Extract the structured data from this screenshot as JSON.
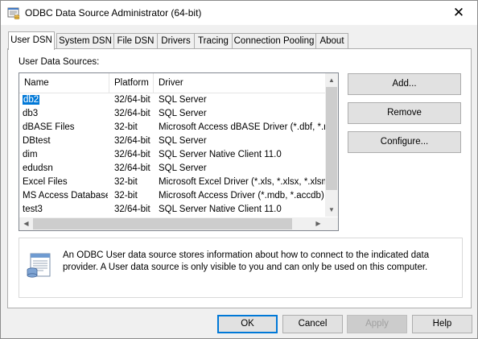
{
  "window": {
    "title": "ODBC Data Source Administrator (64-bit)",
    "close_symbol": "✕"
  },
  "tabs": [
    {
      "label": "User DSN",
      "active": true
    },
    {
      "label": "System DSN",
      "active": false
    },
    {
      "label": "File DSN",
      "active": false
    },
    {
      "label": "Drivers",
      "active": false
    },
    {
      "label": "Tracing",
      "active": false
    },
    {
      "label": "Connection Pooling",
      "active": false
    },
    {
      "label": "About",
      "active": false
    }
  ],
  "list": {
    "label": "User Data Sources:",
    "columns": [
      "Name",
      "Platform",
      "Driver"
    ],
    "selected_index": 0,
    "rows": [
      {
        "name": "db2",
        "platform": "32/64-bit",
        "driver": "SQL Server"
      },
      {
        "name": "db3",
        "platform": "32/64-bit",
        "driver": "SQL Server"
      },
      {
        "name": "dBASE Files",
        "platform": "32-bit",
        "driver": "Microsoft Access dBASE Driver (*.dbf, *.ndx"
      },
      {
        "name": "DBtest",
        "platform": "32/64-bit",
        "driver": "SQL Server"
      },
      {
        "name": "dim",
        "platform": "32/64-bit",
        "driver": "SQL Server Native Client 11.0"
      },
      {
        "name": "edudsn",
        "platform": "32/64-bit",
        "driver": "SQL Server"
      },
      {
        "name": "Excel Files",
        "platform": "32-bit",
        "driver": "Microsoft Excel Driver (*.xls, *.xlsx, *.xlsm, *.x"
      },
      {
        "name": "MS Access Database",
        "platform": "32-bit",
        "driver": "Microsoft Access Driver (*.mdb, *.accdb)"
      },
      {
        "name": "test3",
        "platform": "32/64-bit",
        "driver": "SQL Server Native Client 11.0"
      }
    ]
  },
  "side_buttons": {
    "add": "Add...",
    "remove": "Remove",
    "configure": "Configure..."
  },
  "info": {
    "text": "An ODBC User data source stores information about how to connect to the indicated data provider.   A User data source is only visible to you and can only be used on this computer.",
    "icon": "data-source-icon"
  },
  "bottom_buttons": {
    "ok": "OK",
    "cancel": "Cancel",
    "apply": "Apply",
    "help": "Help"
  },
  "colors": {
    "selection": "#0078d7",
    "default_button_border": "#0078d7"
  }
}
